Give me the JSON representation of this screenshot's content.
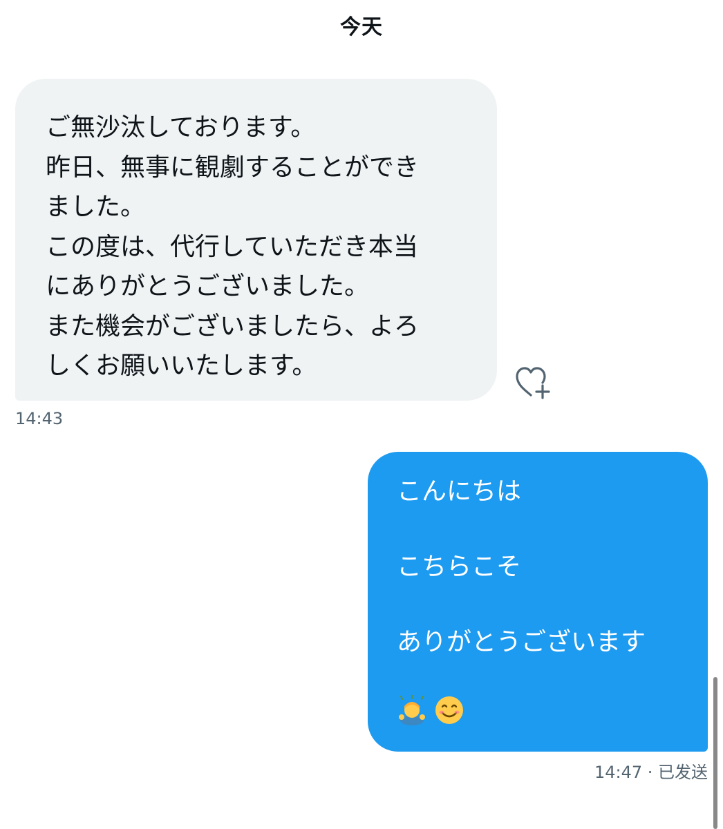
{
  "date_separator": "今天",
  "incoming_message": {
    "lines": [
      "ご無沙汰しております。",
      "昨日、無事に観劇することができ",
      "ました。",
      "この度は、代行していただき本当",
      "にありがとうございました。",
      "また機会がございましたら、よろ",
      "しくお願いいたします。"
    ],
    "time": "14:43"
  },
  "outgoing_message": {
    "lines": [
      "こんにちは",
      "こちらこそ",
      "ありがとうございます"
    ],
    "emojis": [
      "person-bowing-icon",
      "smiling-face-icon"
    ],
    "time_status": "14:47 · 已发送"
  },
  "colors": {
    "incoming_bubble": "#eff3f4",
    "outgoing_bubble": "#1d9bf0",
    "meta_text": "#536471"
  }
}
